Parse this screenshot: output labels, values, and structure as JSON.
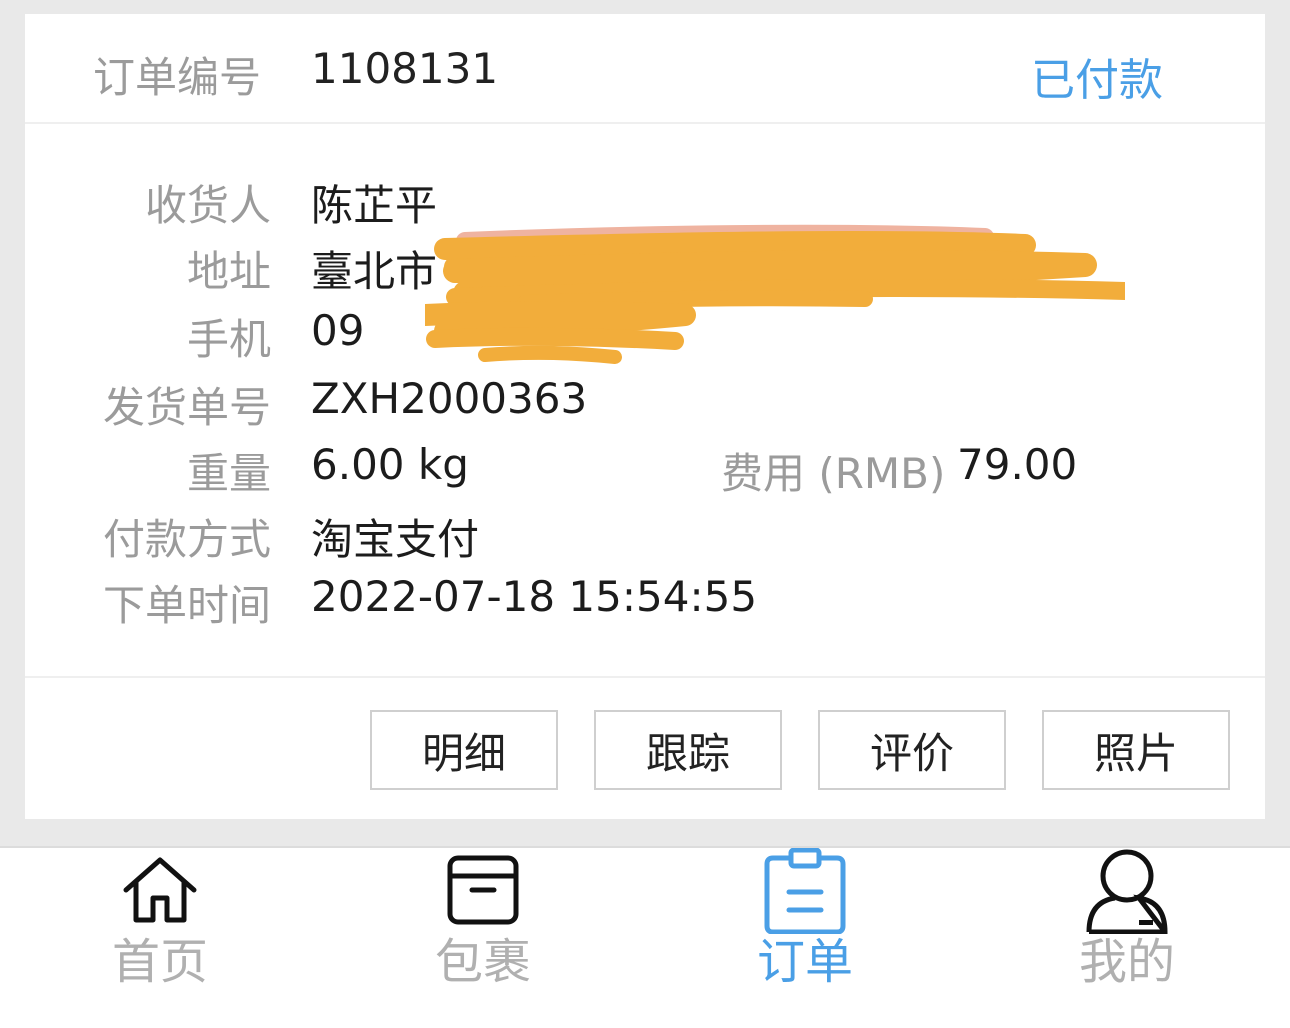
{
  "order": {
    "number_label": "订单编号",
    "number": "1108131",
    "status": "已付款"
  },
  "details": {
    "consignee_label": "收货人",
    "consignee": "陈芷平",
    "address_label": "地址",
    "address": "臺北市",
    "phone_label": "手机",
    "phone": "09",
    "shipment_label": "发货单号",
    "shipment": "ZXH2000363",
    "weight_label": "重量",
    "weight": "6.00 kg",
    "fee_label": "费用 (RMB)",
    "fee": "79.00",
    "payment_label": "付款方式",
    "payment": "淘宝支付",
    "time_label": "下单时间",
    "time": "2022-07-18 15:54:55"
  },
  "actions": {
    "detail": "明细",
    "track": "跟踪",
    "review": "评价",
    "photos": "照片"
  },
  "tabbar": {
    "home": "首页",
    "packages": "包裹",
    "orders": "订单",
    "mine": "我的"
  },
  "colors": {
    "accent": "#4a9fe6",
    "redaction": "#f2ad3b"
  }
}
